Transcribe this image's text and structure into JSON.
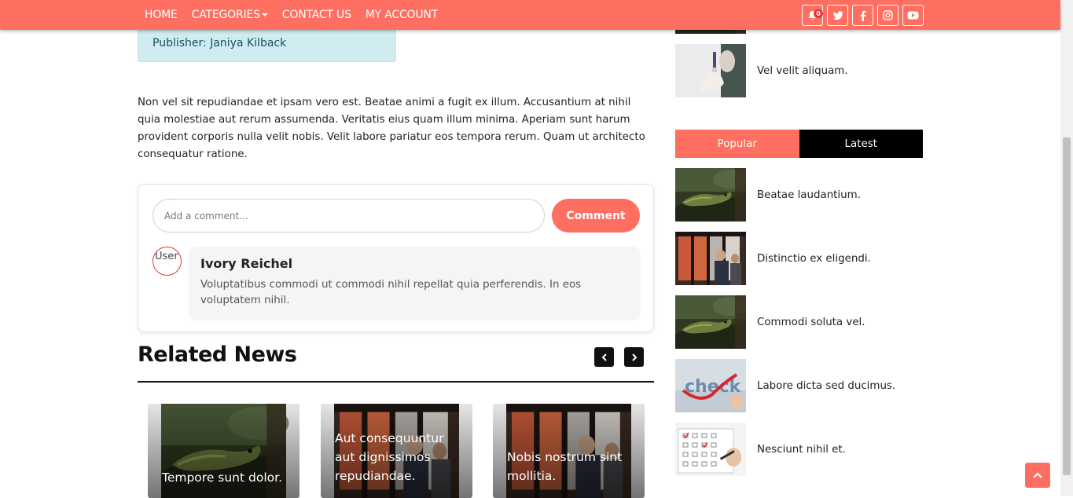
{
  "nav": {
    "links": [
      "HOME",
      "CATEGORIES",
      "CONTACT US",
      "MY ACCOUNT"
    ],
    "notification_count": "0",
    "social_icons": [
      "bell-icon",
      "twitter-icon",
      "facebook-icon",
      "instagram-icon",
      "youtube-icon"
    ]
  },
  "article": {
    "publisher": "Publisher: Janiya Kilback",
    "body": "Non vel sit repudiandae et ipsam vero est. Beatae animi a fugit ex illum. Accusantium at nihil quia molestiae aut rerum assumenda. Veritatis eius quam illum minima. Aperiam sunt harum provident corporis nulla velit nobis. Velit labore pariatur eos tempora rerum. Quam ut architecto consequatur ratione."
  },
  "comments": {
    "placeholder": "Add a comment...",
    "button_label": "Comment",
    "avatar_alt": "User",
    "items": [
      {
        "author": "Ivory Reichel",
        "text": "Voluptatibus commodi ut commodi nihil repellat quia perferendis. In eos voluptatem nihil."
      }
    ]
  },
  "related": {
    "title": "Related News",
    "cards": [
      {
        "title": "Tempore sunt dolor.",
        "image": "iguana"
      },
      {
        "title": "Aut consequuntur aut dignissimos repudiandae.",
        "image": "window-people"
      },
      {
        "title": "Nobis nostrum sint mollitia.",
        "image": "window-people"
      }
    ]
  },
  "sidebar": {
    "top_items": [
      {
        "title": "Vel velit aliquam.",
        "image": "vaccine"
      }
    ],
    "tabs": [
      "Popular",
      "Latest"
    ],
    "active_tab": "Popular",
    "popular": [
      {
        "title": "Beatae laudantium.",
        "image": "iguana"
      },
      {
        "title": "Distinctio ex eligendi.",
        "image": "window-people"
      },
      {
        "title": "Commodi soluta vel.",
        "image": "iguana"
      },
      {
        "title": "Labore dicta sed ducimus.",
        "image": "check"
      },
      {
        "title": "Nesciunt nihil et.",
        "image": "checklist"
      }
    ]
  },
  "colors": {
    "brand": "#fe6f61",
    "dark": "#000000",
    "alert_bg": "#d1ecf1"
  }
}
